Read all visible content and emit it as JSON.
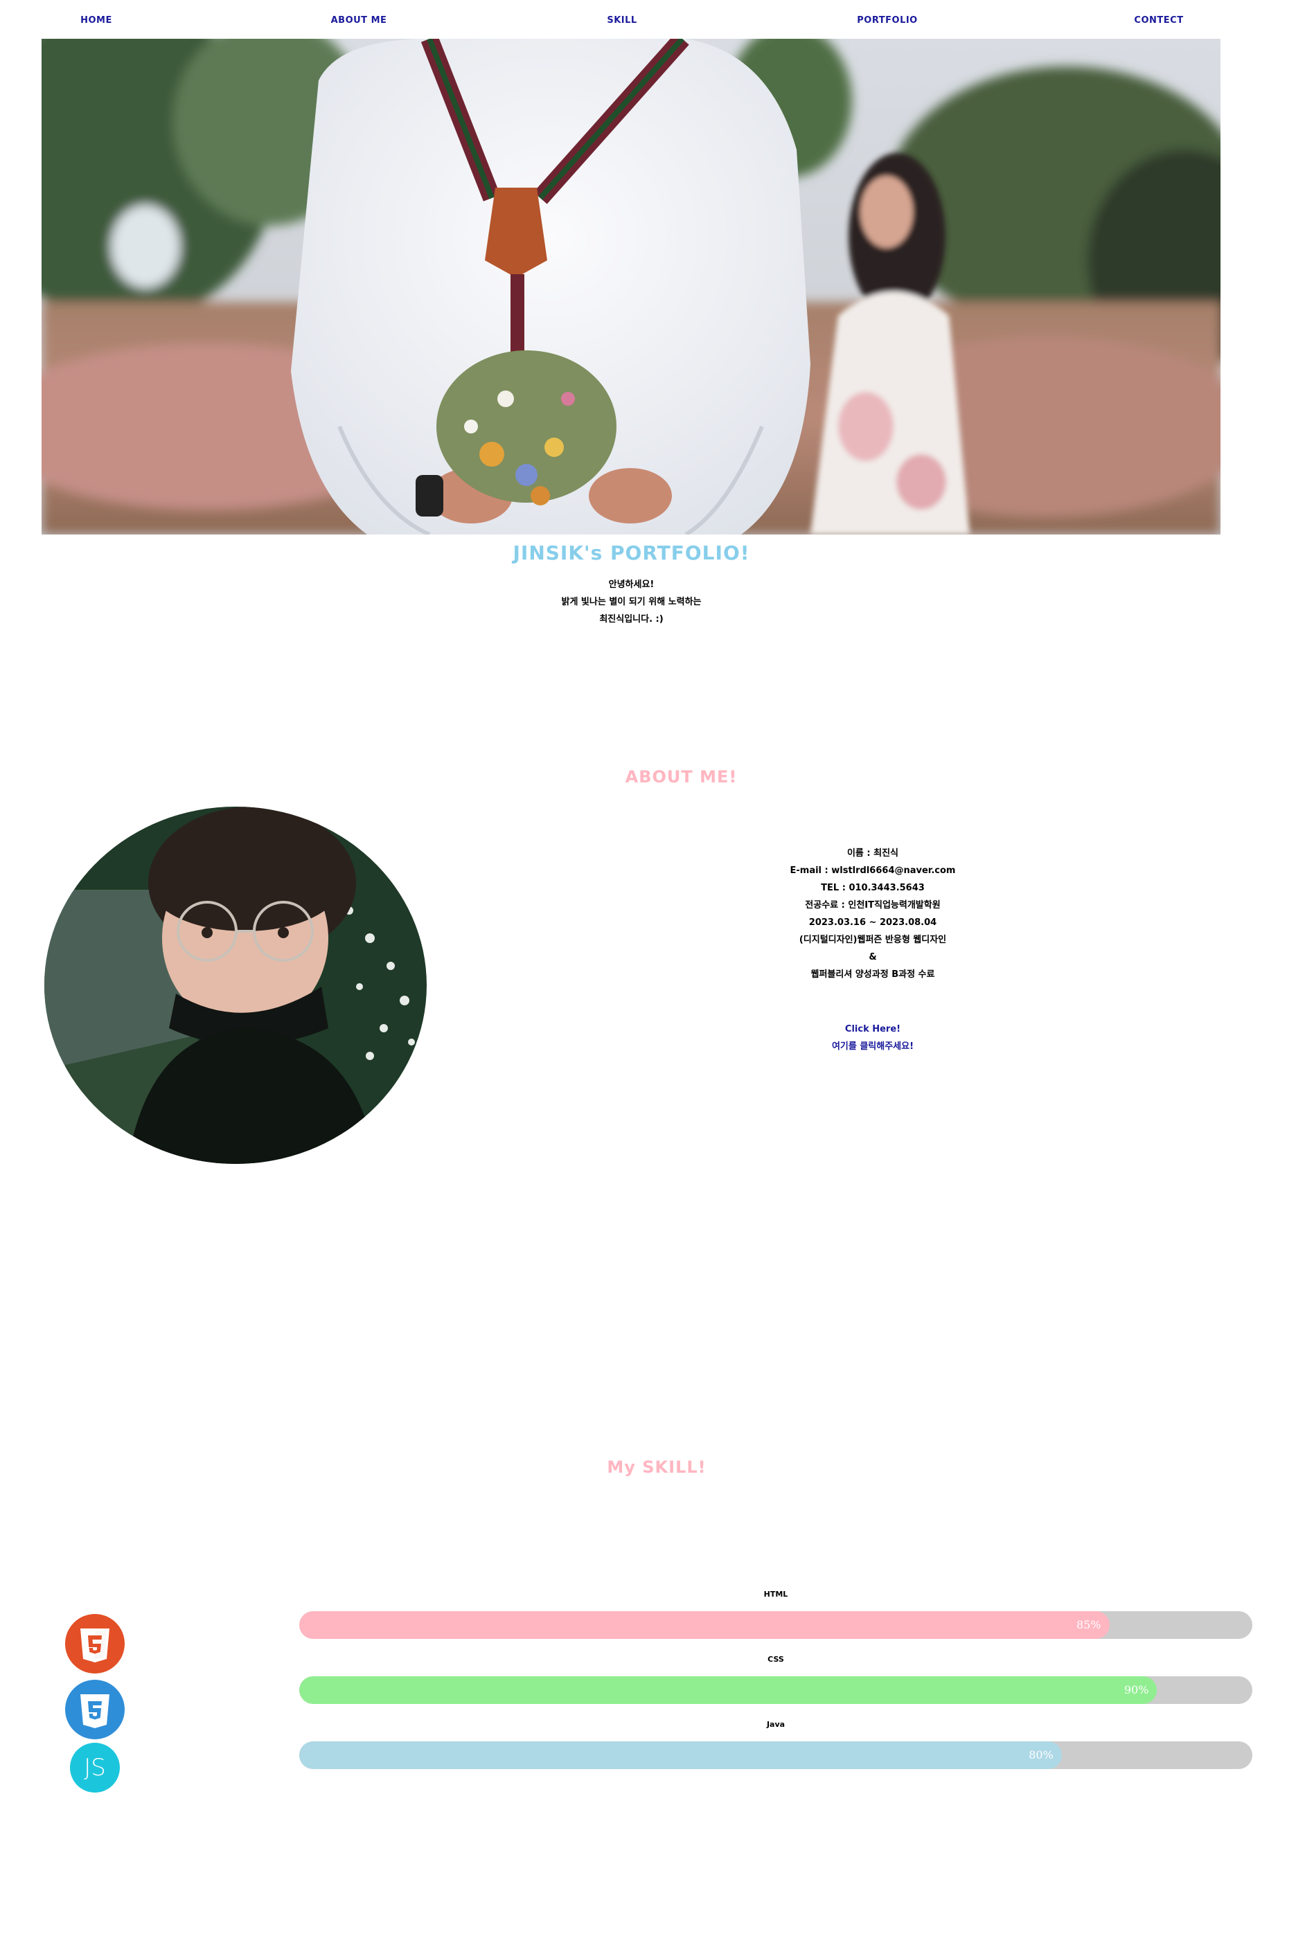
{
  "nav": {
    "items": [
      "HOME",
      "ABOUT ME",
      "SKILL",
      "PORTFOLIO",
      "CONTECT"
    ]
  },
  "hero": {
    "image": "photo of a man in a white shirt with suspenders holding a flower bouquet behind his back, woman in a dress in background"
  },
  "intro": {
    "title": "JINSIK's PORTFOLIO!",
    "lines": [
      "안녕하세요!",
      "밝게 빛나는 별이 되기 위해 노력하는",
      "최진식입니다. :)"
    ]
  },
  "about": {
    "title": "ABOUT ME!",
    "photo": "profile photo of a person wearing round glasses and a black mask pulled under the chin",
    "lines": [
      "이름 : 최진식",
      "E-mail : wlstlrdl6664@naver.com",
      "TEL : 010.3443.5643",
      "전공수료 : 인천IT직업능력개발학원",
      "2023.03.16 ~ 2023.08.04",
      "(디지털디자인)웹퍼즌 반응형 웹디자인",
      "&",
      "웹퍼블리셔 양성과정 B과정 수료"
    ],
    "link_en": "Click Here!",
    "link_ko": "여기를 클릭해주세요!"
  },
  "skill": {
    "title": "My SKILL!",
    "icons": [
      {
        "name": "html5-icon",
        "label": "HTML",
        "glyph": "5",
        "color": "#e34f26"
      },
      {
        "name": "css3-icon",
        "label": "CSS",
        "glyph": "3",
        "color": "#2f8ed8"
      },
      {
        "name": "js-icon",
        "label": "JS",
        "glyph": "JS",
        "color": "#1bc6dc"
      }
    ],
    "bars": [
      {
        "label": "HTML",
        "percent": 85,
        "percent_text": "85%",
        "color": "#ffb6c1"
      },
      {
        "label": "CSS",
        "percent": 90,
        "percent_text": "90%",
        "color": "#90ee90"
      },
      {
        "label": "Java",
        "percent": 80,
        "percent_text": "80%",
        "color": "#add8e6"
      }
    ]
  }
}
